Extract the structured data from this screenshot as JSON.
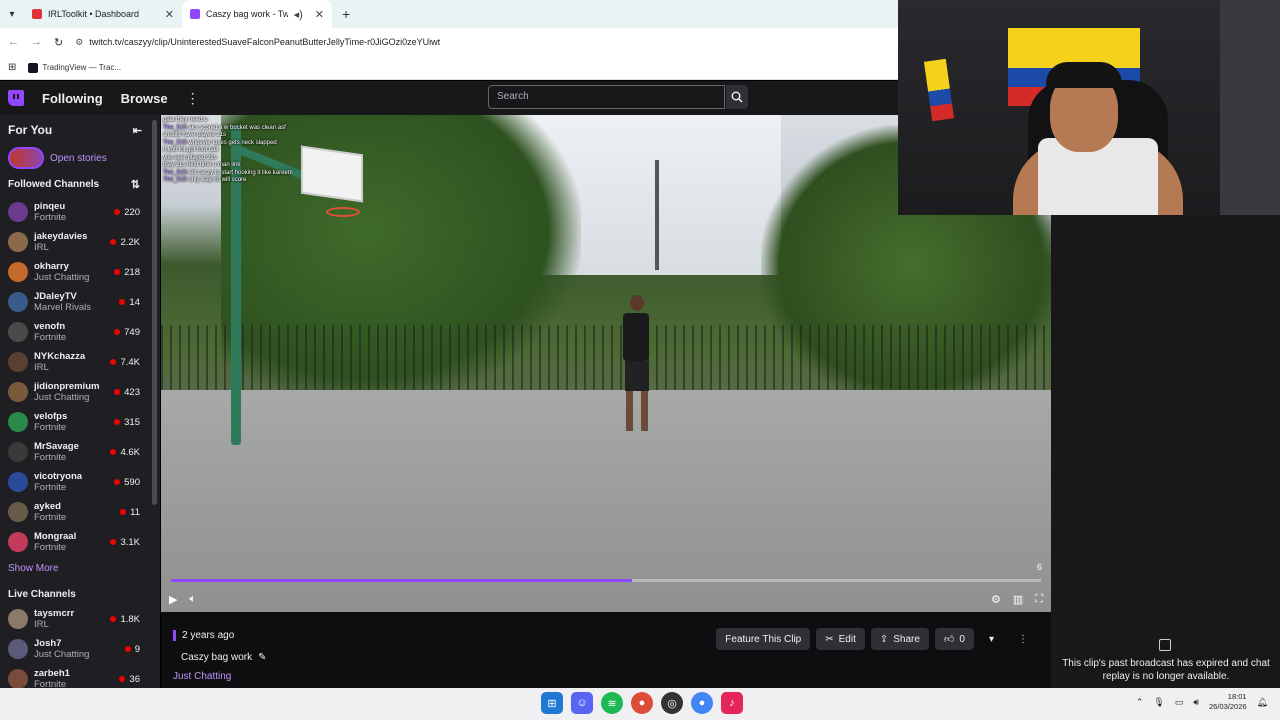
{
  "browser": {
    "tabs": [
      {
        "title": "IRLToolkit • Dashboard",
        "active": false,
        "favicon_color": "#e0343a"
      },
      {
        "title": "Caszy bag work - Twitch",
        "active": true,
        "favicon_color": "#9147ff"
      }
    ],
    "url": "twitch.tv/caszyy/clip/UninterestedSuaveFalconPeanutButterJellyTime-r0JiGOzi0zeYUiwt",
    "bookmark": "TradingView — Trac..."
  },
  "twitch_nav": {
    "following": "Following",
    "browse": "Browse",
    "search_placeholder": "Search"
  },
  "sidebar": {
    "for_you": "For You",
    "open_stories": "Open stories",
    "followed_title": "Followed Channels",
    "followed": [
      {
        "name": "pinqeu",
        "game": "Fortnite",
        "viewers": "220",
        "color": "#6a3b8c"
      },
      {
        "name": "jakeydavies",
        "game": "IRL",
        "viewers": "2.2K",
        "color": "#8a6a4a"
      },
      {
        "name": "okharry",
        "game": "Just Chatting",
        "viewers": "218",
        "color": "#c46a2a"
      },
      {
        "name": "JDaleyTV",
        "game": "Marvel Rivals",
        "viewers": "14",
        "color": "#3a5a8a"
      },
      {
        "name": "venofn",
        "game": "Fortnite",
        "viewers": "749",
        "color": "#4a4a4a"
      },
      {
        "name": "NYKchazza",
        "game": "IRL",
        "viewers": "7.4K",
        "color": "#5a4030"
      },
      {
        "name": "jidionpremium",
        "game": "Just Chatting",
        "viewers": "423",
        "color": "#7a5a3a"
      },
      {
        "name": "velofps",
        "game": "Fortnite",
        "viewers": "315",
        "color": "#2a8a4a"
      },
      {
        "name": "MrSavage",
        "game": "Fortnite",
        "viewers": "4.6K",
        "color": "#3a3a3a"
      },
      {
        "name": "vicotryona",
        "game": "Fortnite",
        "viewers": "590",
        "color": "#2a4a9a"
      },
      {
        "name": "ayked",
        "game": "Fortnite",
        "viewers": "11",
        "color": "#6a5a4a"
      },
      {
        "name": "Mongraal",
        "game": "Fortnite",
        "viewers": "3.1K",
        "color": "#c43a5a"
      }
    ],
    "show_more": "Show More",
    "live_title": "Live Channels",
    "live": [
      {
        "name": "taysmcrr",
        "game": "IRL",
        "viewers": "1.8K",
        "color": "#8a7a6a"
      },
      {
        "name": "Josh7",
        "game": "Just Chatting",
        "viewers": "9",
        "color": "#5a5a7a"
      },
      {
        "name": "zarbeh1",
        "game": "Fortnite",
        "viewers": "36",
        "color": "#7a4a3a"
      }
    ]
  },
  "video_chat": [
    {
      "user": "",
      "msg": "gala they need u"
    },
    {
      "user": "The_515",
      "msg": "aks scored a w bucket was clean asf"
    },
    {
      "user": "",
      "msg": "should have played 21s"
    },
    {
      "user": "The_515",
      "msg": "whoever loses gets neck slapped"
    },
    {
      "user": "",
      "msg": "if you lot got foot ball"
    },
    {
      "user": "",
      "msg": "you ever played 21s"
    },
    {
      "user": "",
      "msg": "play 21s next time u man link"
    },
    {
      "user": "The_515",
      "msg": "tell caszy to start hooking it like kareem"
    },
    {
      "user": "The_515",
      "msg": "only way mf will score"
    }
  ],
  "player": {
    "counter": "6",
    "progress": 0.53
  },
  "clip": {
    "age": "2 years ago",
    "title": "Caszy bag work",
    "category": "Just Chatting",
    "feature_label": "Feature This Clip",
    "edit_label": "Edit",
    "share_label": "Share",
    "likes": "0"
  },
  "right_panel": {
    "message": "This clip's past broadcast has expired and chat replay is no longer available."
  },
  "taskbar": {
    "time": "18:01",
    "date": "26/03/2026"
  }
}
